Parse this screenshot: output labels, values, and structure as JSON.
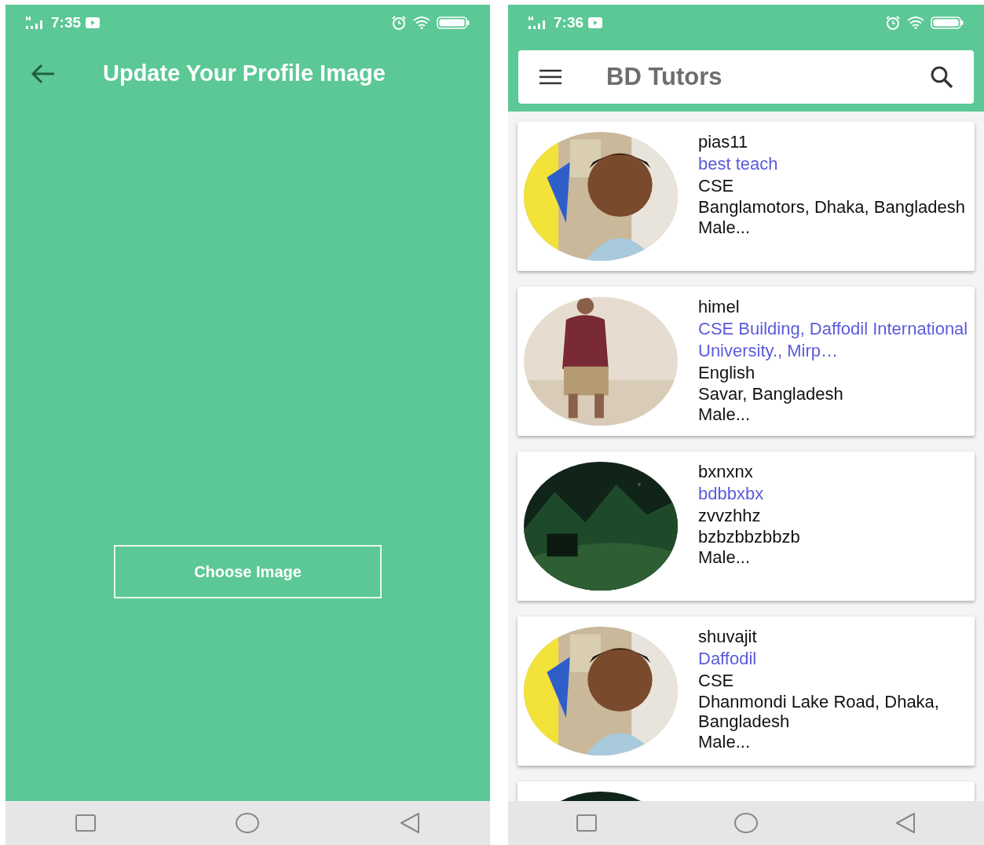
{
  "screens": [
    {
      "kind": "upload",
      "status_bar": {
        "time": "7:35"
      },
      "title": "Update Your Profile Image",
      "button": "Choose Image"
    },
    {
      "kind": "list",
      "status_bar": {
        "time": "7:36"
      },
      "app_bar": {
        "title": "BD Tutors"
      },
      "tutors": [
        {
          "kind": "full",
          "username": "pias11",
          "headline": "best teach",
          "subject": "CSE",
          "location": "Banglamotors, Dhaka, Bangladesh",
          "gender": "Male..."
        },
        {
          "kind": "full",
          "username": "himel",
          "headline": "CSE Building, Daffodil International University., Mirp…",
          "subject": "English",
          "location": "Savar, Bangladesh",
          "gender": "Male..."
        },
        {
          "kind": "full",
          "username": "bxnxnx",
          "headline": "bdbbxbx",
          "subject": "zvvzhhz",
          "location": "bzbzbbzbbzb",
          "gender": "Male..."
        },
        {
          "kind": "full",
          "username": "shuvajit",
          "headline": "Daffodil",
          "subject": "CSE",
          "location": "Dhanmondi Lake Road, Dhaka, Bangladesh",
          "gender": "Male..."
        },
        {
          "kind": "partial"
        }
      ]
    }
  ]
}
